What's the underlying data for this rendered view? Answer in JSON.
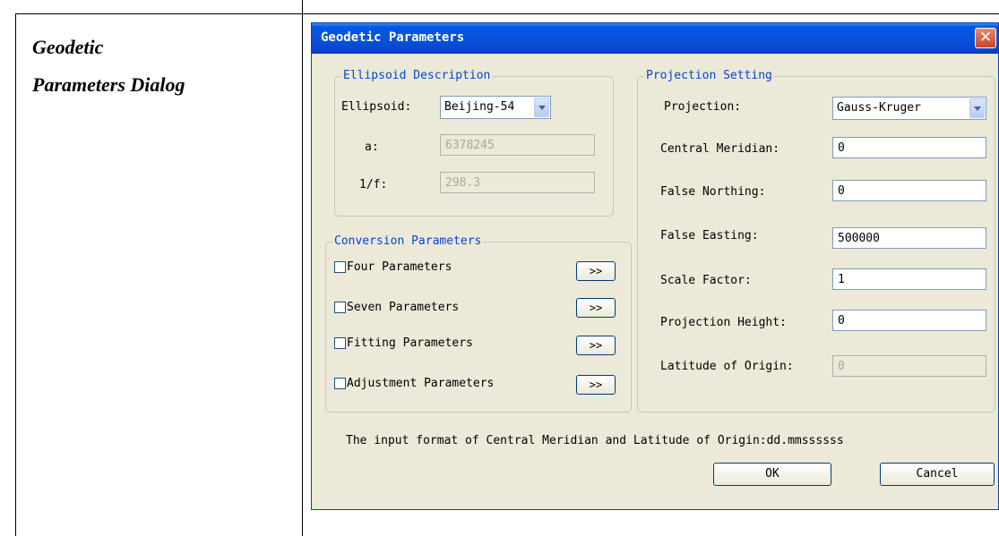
{
  "document": {
    "label_line1": "Geodetic",
    "label_line2": "Parameters Dialog"
  },
  "dialog": {
    "title": "Geodetic Parameters",
    "close_glyph": "✕",
    "ellipsoid_group": {
      "legend": "Ellipsoid Description",
      "ellipsoid_label": "Ellipsoid:",
      "ellipsoid_value": "Beijing-54",
      "a_label": "a:",
      "a_value": "6378245",
      "f_label": "1/f:",
      "f_value": "298.3"
    },
    "conversion_group": {
      "legend": "Conversion Parameters",
      "items": [
        {
          "label": "Four Parameters",
          "checked": false,
          "button": ">>"
        },
        {
          "label": "Seven Parameters",
          "checked": false,
          "button": ">>"
        },
        {
          "label": "Fitting Parameters",
          "checked": false,
          "button": ">>"
        },
        {
          "label": "Adjustment Parameters",
          "checked": false,
          "button": ">>"
        }
      ]
    },
    "projection_group": {
      "legend": "Projection Setting",
      "projection_label": "Projection:",
      "projection_value": "Gauss-Kruger",
      "central_meridian_label": "Central Meridian:",
      "central_meridian_value": "0",
      "false_northing_label": "False Northing:",
      "false_northing_value": "0",
      "false_easting_label": "False Easting:",
      "false_easting_value": "500000",
      "scale_factor_label": "Scale Factor:",
      "scale_factor_value": "1",
      "projection_height_label": "Projection Height:",
      "projection_height_value": "0",
      "latitude_origin_label": "Latitude of Origin:",
      "latitude_origin_value": "0"
    },
    "hint": "The input format of Central Meridian and Latitude of Origin:dd.mmssssss",
    "ok_label": "OK",
    "cancel_label": "Cancel"
  },
  "colors": {
    "titlebar": "#0a52dc",
    "dialog_bg": "#ece9d8",
    "legend_text": "#0046d5"
  }
}
